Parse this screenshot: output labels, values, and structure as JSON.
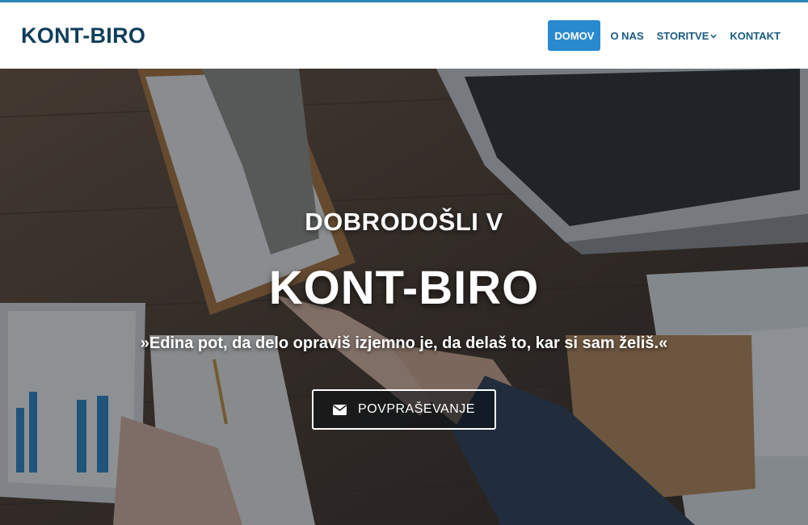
{
  "brand": {
    "name": "KONT-BIRO"
  },
  "nav": {
    "items": [
      {
        "label": "DOMOV",
        "active": true
      },
      {
        "label": "O NAS",
        "active": false
      },
      {
        "label": "STORITVE",
        "active": false,
        "has_dropdown": true
      },
      {
        "label": "KONTAKT",
        "active": false
      }
    ],
    "dropdown_icon": "chevron-down-icon"
  },
  "hero": {
    "pretitle": "DOBRODOŠLI V",
    "title": "KONT-BIRO",
    "quote": "»Edina pot, da delo opraviš izjemno je, da delaš to, kar si sam želiš.«",
    "cta_label": "POVPRAŠEVANJE",
    "cta_icon": "envelope-icon"
  },
  "colors": {
    "accent": "#2a87b8",
    "nav_text": "#1b5b82",
    "brand_text": "#0f3e5a",
    "active_bg": "#2a8ad0"
  }
}
